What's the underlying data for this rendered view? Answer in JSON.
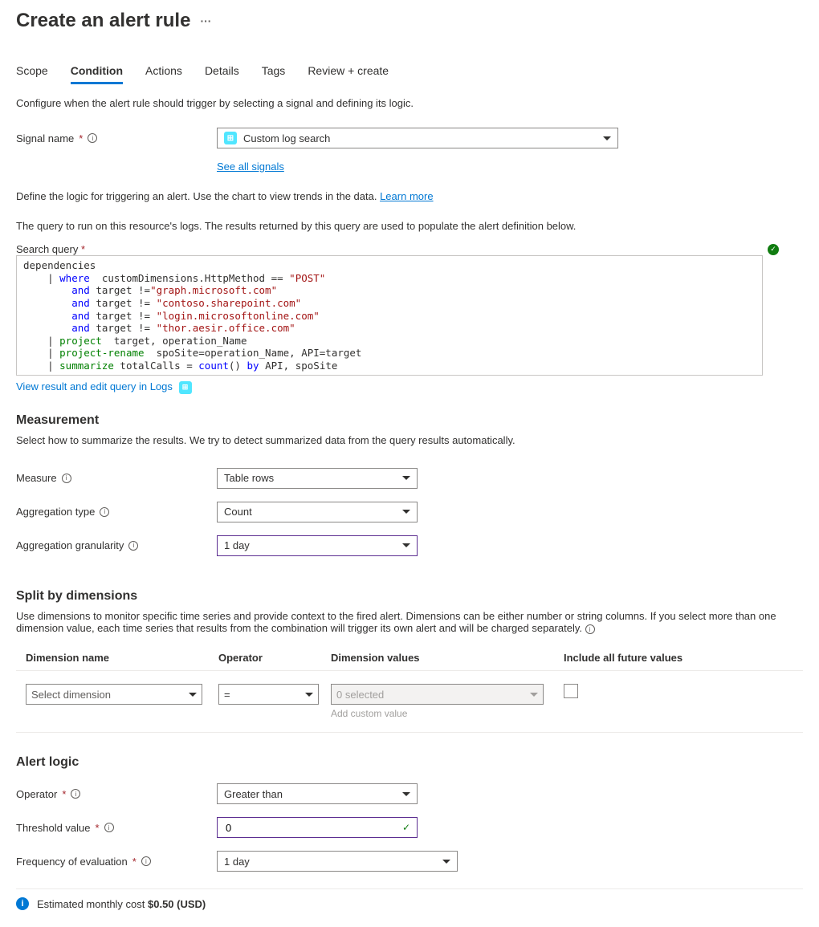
{
  "header": {
    "title": "Create an alert rule"
  },
  "tabs": [
    "Scope",
    "Condition",
    "Actions",
    "Details",
    "Tags",
    "Review + create"
  ],
  "active_tab": "Condition",
  "condition": {
    "intro": "Configure when the alert rule should trigger by selecting a signal and defining its logic.",
    "signal_label": "Signal name",
    "signal_value": "Custom log search",
    "see_all": "See all signals",
    "define_text": "Define the logic for triggering an alert. Use the chart to view trends in the data. ",
    "learn_more": "Learn more",
    "query_intro": "The query to run on this resource's logs. The results returned by this query are used to populate the alert definition below.",
    "search_query_label": "Search query",
    "view_result": "View result and edit query in Logs"
  },
  "query": {
    "l1": "dependencies",
    "l2a": "where",
    "l2b": "customDimensions.HttpMethod ==",
    "l2c": "\"POST\"",
    "l3a": "and",
    "l3b": "target !=",
    "l3c": "\"graph.microsoft.com\"",
    "l4a": "and",
    "l4b": "target !=",
    "l4c": "\"contoso.sharepoint.com\"",
    "l5a": "and",
    "l5b": "target !=",
    "l5c": "\"login.microsoftonline.com\"",
    "l6a": "and",
    "l6b": "target !=",
    "l6c": "\"thor.aesir.office.com\"",
    "l7a": "project",
    "l7b": "target, operation_Name",
    "l8a": "project-rename",
    "l8b": "spoSite=operation_Name, API=target",
    "l9a": "summarize",
    "l9b": "totalCalls =",
    "l9c": "count",
    "l9d": "()",
    "l9e": "by",
    "l9f": "API, spoSite"
  },
  "measurement": {
    "heading": "Measurement",
    "intro": "Select how to summarize the results. We try to detect summarized data from the query results automatically.",
    "measure_label": "Measure",
    "measure_value": "Table rows",
    "agg_type_label": "Aggregation type",
    "agg_type_value": "Count",
    "agg_gran_label": "Aggregation granularity",
    "agg_gran_value": "1 day"
  },
  "split": {
    "heading": "Split by dimensions",
    "intro": "Use dimensions to monitor specific time series and provide context to the fired alert. Dimensions can be either number or string columns. If you select more than one dimension value, each time series that results from the combination will trigger its own alert and will be charged separately.",
    "col_name": "Dimension name",
    "col_op": "Operator",
    "col_val": "Dimension values",
    "col_inc": "Include all future values",
    "name_ph": "Select dimension",
    "op_val": "=",
    "val_ph": "0 selected",
    "add_custom": "Add custom value"
  },
  "logic": {
    "heading": "Alert logic",
    "operator_label": "Operator",
    "operator_value": "Greater than",
    "threshold_label": "Threshold value",
    "threshold_value": "0",
    "freq_label": "Frequency of evaluation",
    "freq_value": "1 day"
  },
  "cost": {
    "label": "Estimated monthly cost ",
    "value": "$0.50 (USD)"
  }
}
